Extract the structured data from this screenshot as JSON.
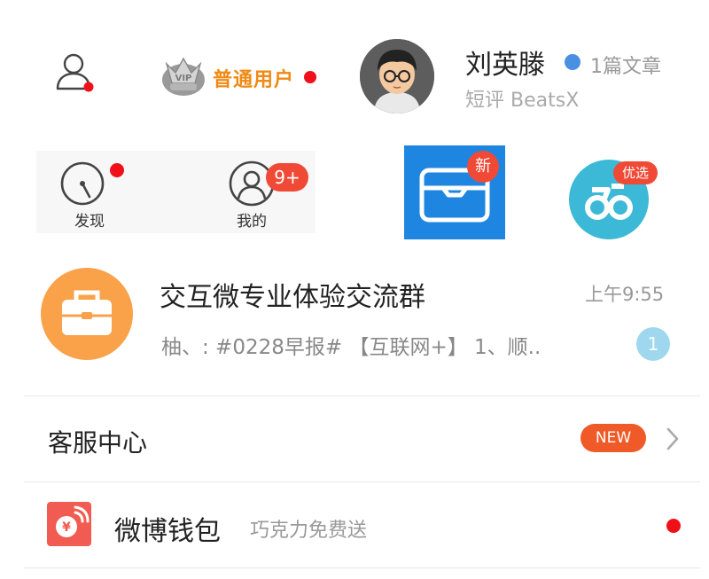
{
  "header": {
    "user_level": "普通用户",
    "profile": {
      "name": "刘英滕",
      "article_count": "1篇文章",
      "subtitle": "短评 BeatsX"
    }
  },
  "shortcuts": {
    "discover_label": "发现",
    "mine_label": "我的",
    "mine_badge": "9+",
    "wallet_badge": "新",
    "pick_badge": "优选"
  },
  "chat": {
    "title": "交互微专业体验交流群",
    "time": "上午9:55",
    "preview": "柚、: #0228早报# 【互联网+】 1、顺..",
    "unread": "1"
  },
  "menu": {
    "service_center": "客服中心",
    "service_badge": "NEW",
    "wallet_label": "微博钱包",
    "wallet_sub": "巧克力免费送"
  },
  "colors": {
    "accent_orange": "#f08a14",
    "badge_red": "#f04a36",
    "blue_app": "#1e86e0",
    "teal_app": "#3cb9d6",
    "chat_avatar": "#f9a24a"
  }
}
